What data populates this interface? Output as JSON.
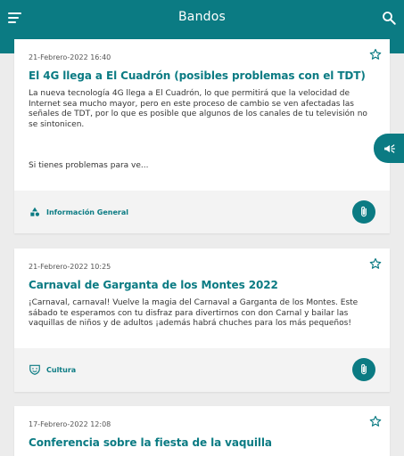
{
  "appbar": {
    "title": "Bandos"
  },
  "colors": {
    "primary": "#0b7b83",
    "background": "#ececec"
  },
  "icons": {
    "menu": "menu-icon",
    "search": "search-icon",
    "star": "star-outline-icon",
    "clip": "paperclip-icon",
    "megaphone": "megaphone-icon"
  },
  "cards": [
    {
      "date": "21-Febrero-2022 16:40",
      "title": "El 4G llega a El Cuadrón (posibles problemas con el TDT)",
      "body": "La nueva tecnología 4G llega a El Cuadrón, lo que permitirá que la velocidad de Internet sea mucho mayor, pero en este proceso de cambio se ven afectadas las señales de TDT, por lo que es posible que algunos de los canales de tu televisión no se sintonicen.",
      "more": "Si tienes problemas para ve...",
      "category": "Información General"
    },
    {
      "date": "21-Febrero-2022 10:25",
      "title": "Carnaval de Garganta de los Montes 2022",
      "body": "¡Carnaval, carnaval! Vuelve la magia del Carnaval a Garganta de los Montes. Este sábado te esperamos con tu disfraz para divertirnos con don Carnal y bailar las vaquillas de niños y de adultos ¡además habrá chuches para los más pequeños!",
      "category": "Cultura"
    },
    {
      "date": "17-Febrero-2022 12:08",
      "title": "Conferencia sobre la fiesta de la vaquilla"
    }
  ]
}
